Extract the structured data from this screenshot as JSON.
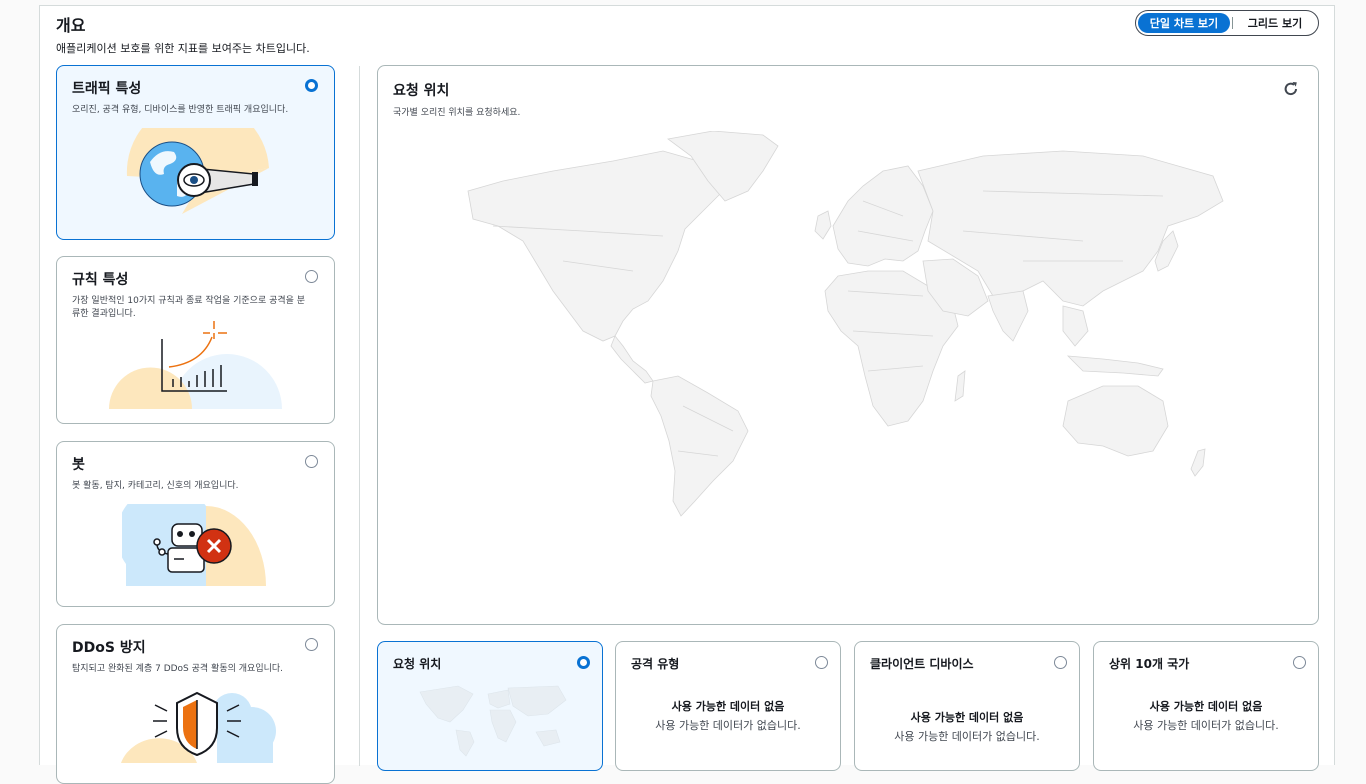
{
  "header": {
    "title": "개요",
    "description": "애플리케이션 보호를 위한 지표를 보여주는 차트입니다."
  },
  "view_toggle": {
    "single": "단일 차트 보기",
    "grid": "그리드 보기",
    "selected": "single"
  },
  "categories": [
    {
      "title": "트래픽 특성",
      "description": "오리진, 공격 유형, 디바이스를 반영한 트래픽 개요입니다.",
      "selected": true
    },
    {
      "title": "규칙 특성",
      "description": "가장 일반적인 10가지 규칙과 종료 작업을 기준으로 공격을 분류한 결과입니다.",
      "selected": false
    },
    {
      "title": "봇",
      "description": "봇 활동, 탐지, 카테고리, 신호의 개요입니다.",
      "selected": false
    },
    {
      "title": "DDoS 방지",
      "description": "탐지되고 완화된 계층 7 DDoS 공격 활동의 개요입니다.",
      "selected": false
    }
  ],
  "main_chart": {
    "title": "요청 위치",
    "description": "국가별 오리진 위치를 요청하세요.",
    "refresh_icon": "refresh-icon"
  },
  "mini_charts": [
    {
      "title": "요청 위치",
      "selected": true,
      "nodata_title": "",
      "nodata_desc": ""
    },
    {
      "title": "공격 유형",
      "selected": false,
      "nodata_title": "사용 가능한 데이터 없음",
      "nodata_desc": "사용 가능한 데이터가 없습니다."
    },
    {
      "title": "클라이언트 디바이스",
      "selected": false,
      "nodata_title": "사용 가능한 데이터 없음",
      "nodata_desc": "사용 가능한 데이터가 없습니다."
    },
    {
      "title": "상위 10개 국가",
      "selected": false,
      "nodata_title": "사용 가능한 데이터 없음",
      "nodata_desc": "사용 가능한 데이터가 없습니다."
    }
  ],
  "colors": {
    "accent": "#0972d3",
    "selected_bg": "#f0f8ff",
    "border": "#aab7b8",
    "map_land": "#f2f2f2",
    "map_line": "#d9d9d9"
  }
}
